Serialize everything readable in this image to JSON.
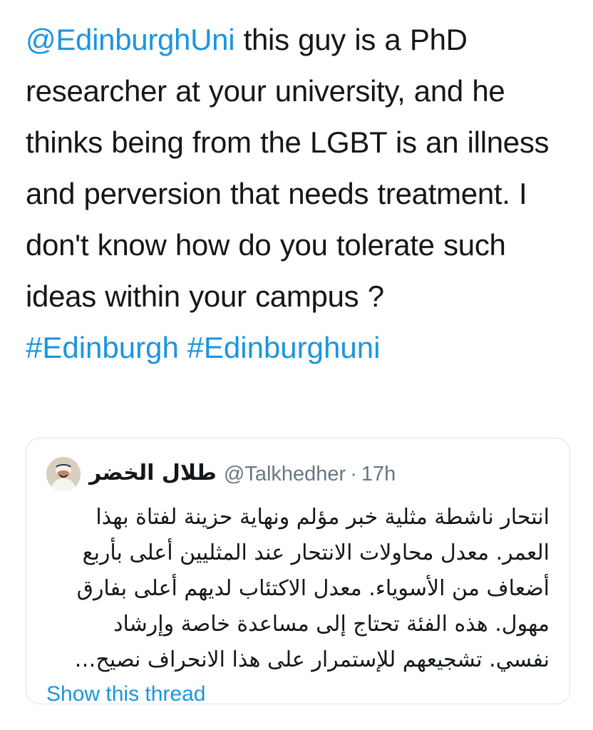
{
  "tweet": {
    "mention": "@EdinburghUni",
    "text": " this guy is a PhD researcher at your university, and he thinks being from the LGBT is an illness and perversion that needs treatment. I don't know how do you tolerate such ideas within your campus ?",
    "hashtags": [
      "#Edinburgh",
      "#Edinburghuni"
    ]
  },
  "quote": {
    "author_name": "طلال الخضر",
    "handle": "@Talkhedher",
    "separator": "·",
    "time": "17h",
    "body": "انتحار ناشطة مثلية خبر مؤلم ونهاية حزينة لفتاة بهذا العمر. معدل محاولات الانتحار عند المثليين أعلى بأربع أضعاف من الأسوياء. معدل الاكتئاب لديهم أعلى بفارق مهول. هذه الفئة تحتاج إلى مساعدة خاصة وإرشاد نفسي. تشجيعهم للإستمرار على هذا الانحراف نصيح…",
    "show_thread": "Show this thread"
  },
  "colors": {
    "link": "#1b95e0",
    "text": "#14171a",
    "muted": "#657786",
    "border": "#dfe3e7"
  },
  "icons": {
    "avatar": "user-avatar"
  }
}
